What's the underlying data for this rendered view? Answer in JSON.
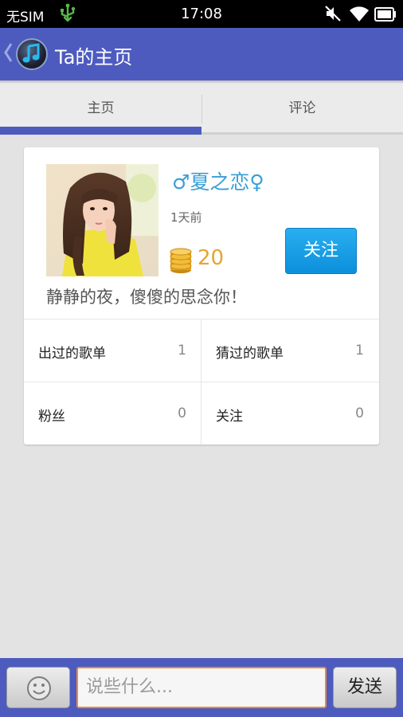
{
  "status_bar": {
    "carrier": "无SIM",
    "time": "17:08",
    "icons": [
      "usb-icon",
      "mute-icon",
      "wifi-icon",
      "battery-icon"
    ]
  },
  "app_bar": {
    "title": "Ta的主页",
    "icons": [
      "back-chevron-icon",
      "music-note-icon"
    ],
    "bar_color": "#4d5bbf"
  },
  "tabs": [
    {
      "label": "主页",
      "selected": true
    },
    {
      "label": "评论",
      "selected": false
    }
  ],
  "profile": {
    "name": "♂夏之恋♀",
    "time_ago": "1天前",
    "coins": "20",
    "follow_label": "关注",
    "signature": "静静的夜，傻傻的思念你！",
    "name_color": "#3a9fd8",
    "coin_color": "#e5a432"
  },
  "stats": [
    {
      "label": "出过的歌单",
      "value": "1"
    },
    {
      "label": "猜过的歌单",
      "value": "1"
    },
    {
      "label": "粉丝",
      "value": "0"
    },
    {
      "label": "关注",
      "value": "0"
    }
  ],
  "composer": {
    "placeholder": "说些什么...",
    "send_label": "发送",
    "emoji_icon": "smiley-icon",
    "input_border_color": "#e98b3a"
  }
}
